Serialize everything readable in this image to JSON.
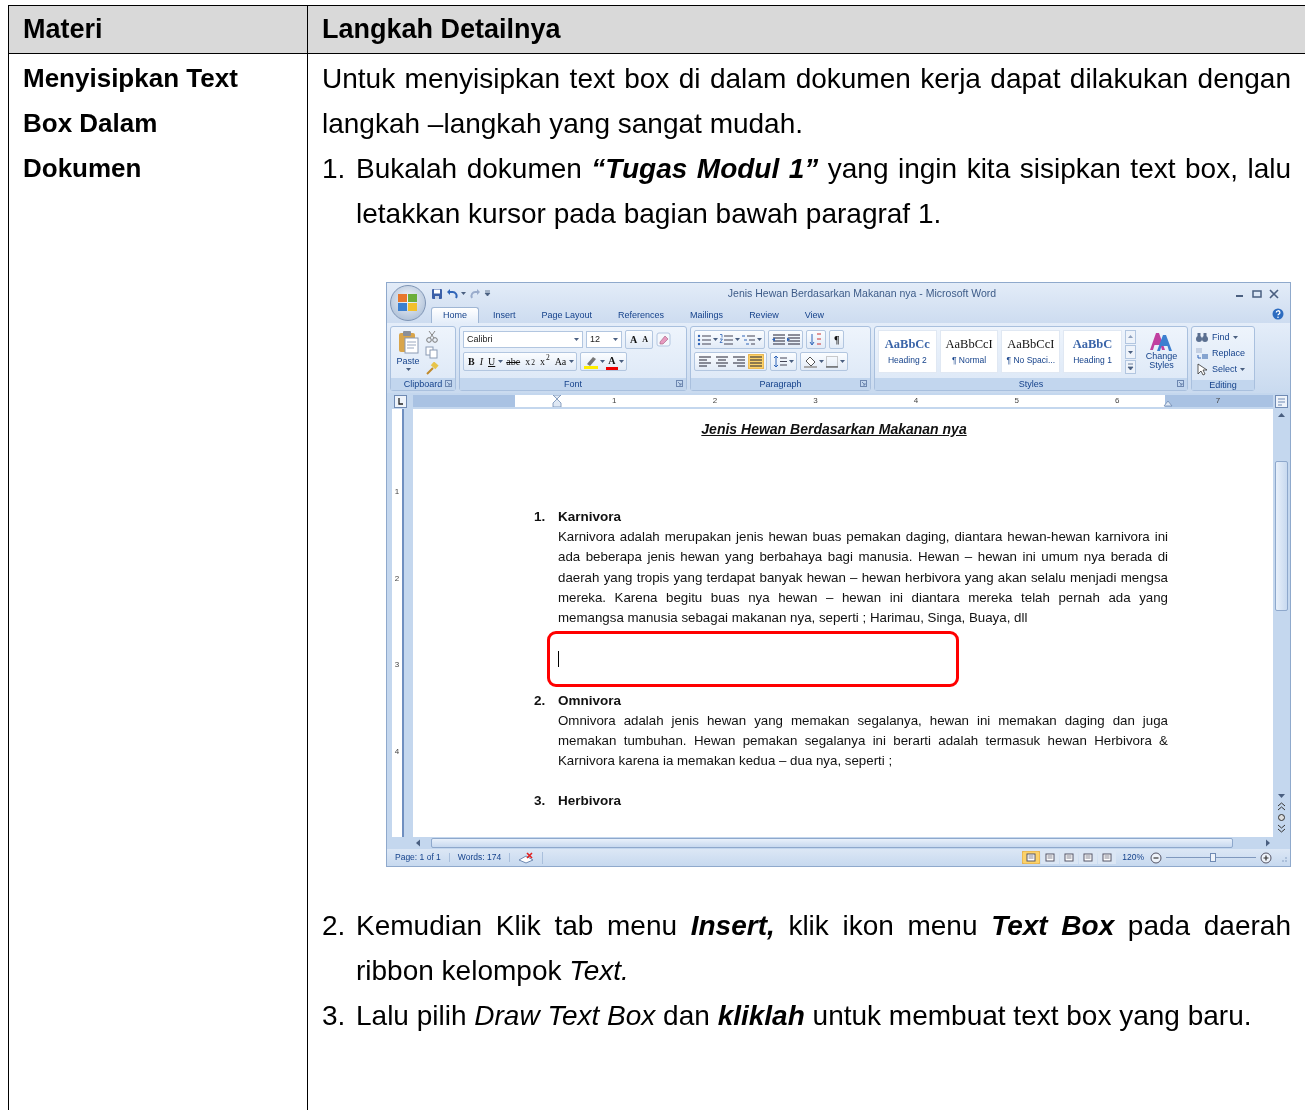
{
  "table": {
    "columns": [
      {
        "label": "Materi"
      },
      {
        "label": "Langkah Detailnya"
      }
    ],
    "topic": "Menyisipkan Text Box Dalam Dokumen",
    "content": [
      {
        "kind": "paragraph",
        "text": "Untuk menyisipkan text box di dalam dokumen kerja dapat dilakukan dengan langkah –langkah yang sangat mudah."
      },
      {
        "kind": "step",
        "number": "1.",
        "text": "Bukalah dokumen **“Tugas Modul 1”** yang ingin kita sisipkan text box, lalu letakkan kursor pada bagian bawah paragraf 1."
      },
      {
        "kind": "screenshot",
        "window": {
          "title": "Jenis Hewan Berdasarkan Makanan nya - Microsoft Word",
          "tabs": [
            {
              "label": "Home",
              "selected": true
            },
            {
              "label": "Insert",
              "selected": false
            },
            {
              "label": "Page Layout",
              "selected": false
            },
            {
              "label": "References",
              "selected": false
            },
            {
              "label": "Mailings",
              "selected": false
            },
            {
              "label": "Review",
              "selected": false
            },
            {
              "label": "View",
              "selected": false
            }
          ],
          "clipboard": {
            "paste": "Paste",
            "label": "Clipboard"
          },
          "font": {
            "name": "Calibri",
            "size": "12",
            "grow": "A",
            "shrink": "A",
            "format_buttons": [
              "B",
              "I",
              "U",
              "abe",
              "x$_{2}$",
              "x$^{2}$",
              "Aa"
            ],
            "color_button": "A",
            "label": "Font"
          },
          "paragraph": {
            "pilcrow": "¶",
            "alignment": [
              {
                "selected": false
              },
              {
                "selected": false
              },
              {
                "selected": false
              },
              {
                "selected": true
              }
            ],
            "label": "Paragraph"
          },
          "styles": {
            "items": [
              {
                "preview": "AaBbCc",
                "name": "Heading 2",
                "kind": "heading"
              },
              {
                "preview": "AaBbCcI",
                "name": "¶ Normal",
                "kind": "body"
              },
              {
                "preview": "AaBbCcI",
                "name": "¶ No Spaci...",
                "kind": "body"
              },
              {
                "preview": "AaBbC",
                "name": "Heading 1",
                "kind": "heading"
              }
            ],
            "change": "Change Styles",
            "label": "Styles"
          },
          "editing": {
            "items": [
              {
                "label": "Find",
                "kind": "find"
              },
              {
                "label": "Replace",
                "kind": "replace"
              },
              {
                "label": "Select",
                "kind": "select"
              }
            ],
            "label": "Editing"
          },
          "ruler": {
            "marks": [
              "1",
              "2",
              "3",
              "4",
              "5",
              "6",
              "7"
            ]
          },
          "vertical_ruler": {
            "marks": [
              "1",
              "2",
              "3",
              "4"
            ]
          },
          "document": {
            "title": "Jenis Hewan Berdasarkan Makanan nya",
            "blocks": [
              {
                "kind": "section",
                "number": "1.",
                "heading": "Karnivora",
                "text": "Karnivora adalah merupakan jenis hewan buas pemakan daging, diantara hewan-hewan karnivora ini ada beberapa jenis hewan yang berbahaya bagi manusia. Hewan – hewan ini umum nya berada di daerah yang tropis yang terdapat banyak hewan – hewan herbivora yang akan selalu menjadi mengsa mereka. Karena begitu buas nya hewan – hewan ini diantara mereka telah pernah ada yang memangsa manusia sebagai makanan nya, seperti ; Harimau, Singa, Buaya, dll"
              },
              {
                "kind": "cursor"
              },
              {
                "kind": "section",
                "number": "2.",
                "heading": "Omnivora",
                "text": "Omnivora adalah jenis hewan yang memakan segalanya, hewan ini memakan daging dan juga memakan tumbuhan. Hewan pemakan segalanya ini berarti adalah termasuk hewan Herbivora & Karnivora karena ia memakan kedua – dua nya, seperti ;"
              },
              {
                "kind": "section",
                "number": "3.",
                "heading": "Herbivora"
              }
            ]
          },
          "status": {
            "page": "Page: 1 of 1",
            "words": "Words: 174",
            "views": [
              {
                "selected": true
              },
              {
                "selected": false
              },
              {
                "selected": false
              },
              {
                "selected": false
              },
              {
                "selected": false
              }
            ],
            "zoom": "120%",
            "zoom_slider": {
              "level": 0.52
            }
          }
        }
      },
      {
        "kind": "step",
        "number": "2.",
        "text": "Kemudian Klik tab menu **Insert,** klik ikon menu **Text Box** pada daerah ribbon kelompok *Text.*"
      },
      {
        "kind": "step",
        "number": "3.",
        "text": "Lalu pilih *Draw Text Box* dan **kliklah**  untuk membuat text box yang baru."
      }
    ]
  }
}
